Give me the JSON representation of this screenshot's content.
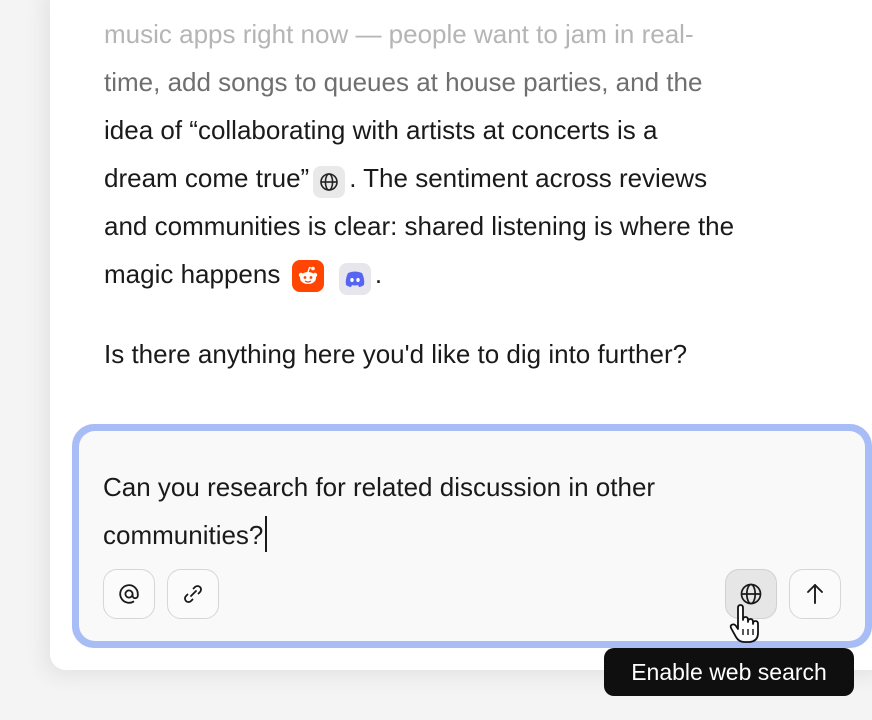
{
  "response": {
    "line_1": "music apps right now — people want to jam in real-",
    "line_2": "time, add songs to queues at house parties, and the",
    "line_3": "idea of “collaborating with artists at concerts is a",
    "line_4_before": "dream come true”",
    "line_4_after": ". The sentiment across reviews",
    "line_5": "and communities is clear: shared listening is where the",
    "line_6": "magic happens",
    "line_6_after": ".",
    "question": "Is there anything here you'd like to dig into further?",
    "source_icons": [
      "globe-icon",
      "reddit-icon",
      "discord-icon"
    ]
  },
  "composer": {
    "text": "Can you research for related discussion in other communities?",
    "buttons": {
      "mention": "at-sign-icon",
      "attach": "paperclip-icon",
      "web_search": "globe-icon",
      "send": "arrow-up-icon"
    },
    "focus_color": "#a8bdf6"
  },
  "tooltip": {
    "label": "Enable web search"
  }
}
